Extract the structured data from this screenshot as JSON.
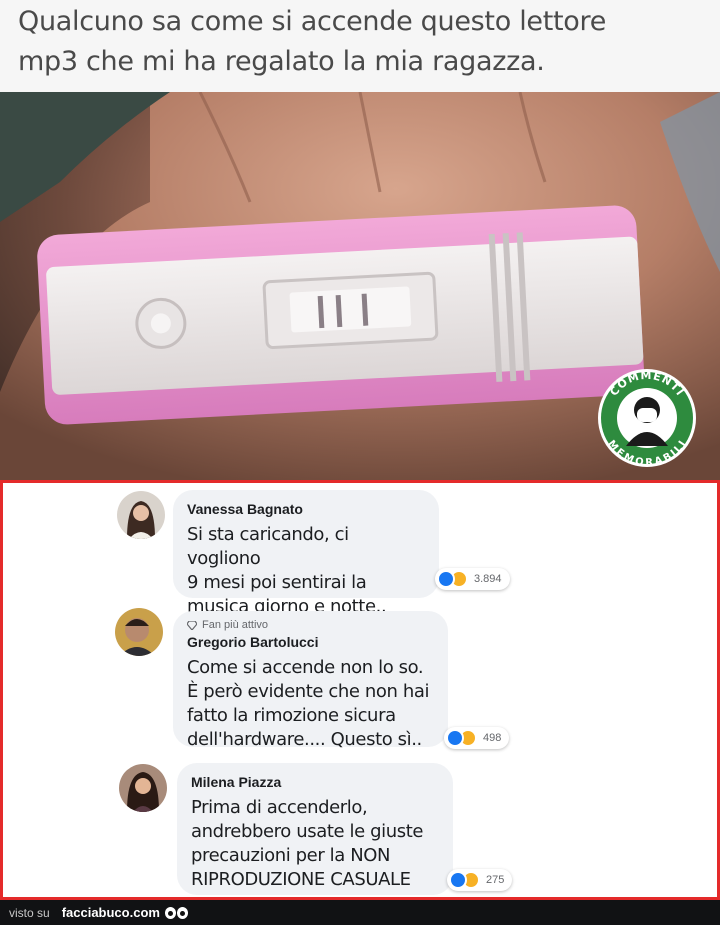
{
  "caption": {
    "line1": "Qualcuno sa come si accende questo lettore",
    "line2": "mp3 che mi ha regalato la mia ragazza."
  },
  "stamp": {
    "top_text": "COMMENTI",
    "bottom_text": "MEMORABILI",
    "colors": {
      "ring": "#2e8b3e",
      "inner": "#ffffff"
    }
  },
  "comments": [
    {
      "name": "Vanessa Bagnato",
      "lines": [
        "Si sta caricando, ci vogliono",
        "9 mesi poi sentirai la",
        "musica giorno e notte.."
      ],
      "reaction_count": "3.894"
    },
    {
      "badge": "Fan più attivo",
      "name": "Gregorio Bartolucci",
      "lines": [
        "Come si accende non lo so.",
        "È però evidente che non hai",
        "fatto la rimozione sicura",
        "dell'hardware.... Questo sì.."
      ],
      "reaction_count": "498"
    },
    {
      "name": "Milena Piazza",
      "lines": [
        "Prima di accenderlo,",
        "andrebbero usate le giuste",
        "precauzioni per la NON",
        "RIPRODUZIONE CASUALE"
      ],
      "reaction_count": "275"
    }
  ],
  "footer": {
    "visto_su": "visto su",
    "brand": "facciabuco.com"
  },
  "colors": {
    "frame": "#e42a2a",
    "bubble": "#f0f2f5",
    "like": "#1877f2",
    "haha": "#f7b125"
  }
}
